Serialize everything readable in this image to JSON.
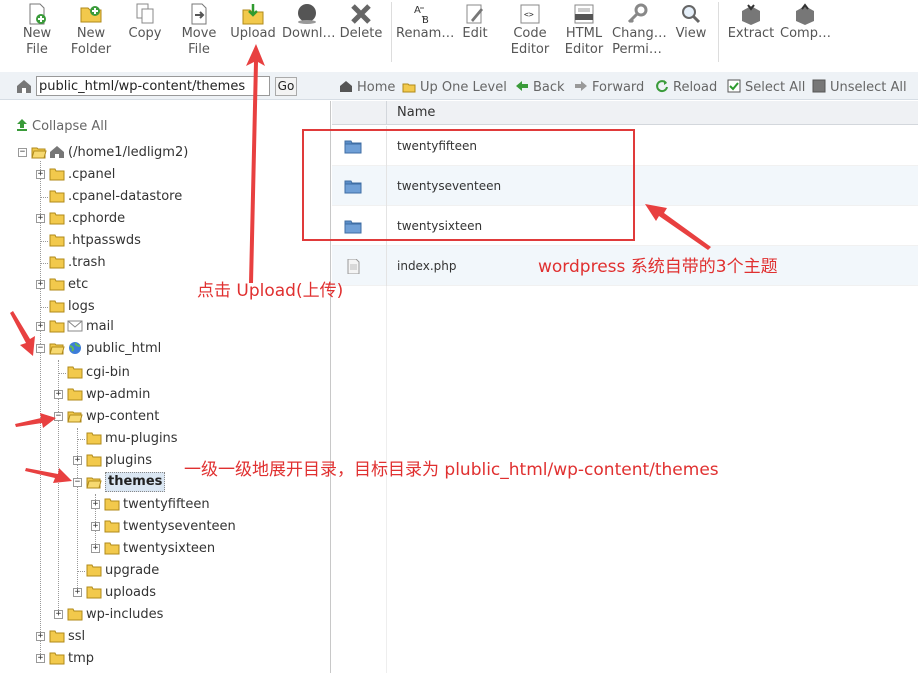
{
  "toolbar": {
    "buttons": [
      {
        "label": "New\nFile",
        "icon": "new-file-icon"
      },
      {
        "label": "New\nFolder",
        "icon": "new-folder-icon"
      },
      {
        "label": "Copy",
        "icon": "copy-icon"
      },
      {
        "label": "Move\nFile",
        "icon": "move-file-icon"
      },
      {
        "label": "Upload",
        "icon": "upload-icon"
      },
      {
        "label": "Downl…",
        "icon": "download-icon"
      },
      {
        "label": "Delete",
        "icon": "delete-icon"
      },
      {
        "label": "Renam…",
        "icon": "rename-icon"
      },
      {
        "label": "Edit",
        "icon": "edit-icon"
      },
      {
        "label": "Code\nEditor",
        "icon": "code-editor-icon"
      },
      {
        "label": "HTML\nEditor",
        "icon": "html-editor-icon"
      },
      {
        "label": "Chang…\nPermi…",
        "icon": "permissions-icon"
      },
      {
        "label": "View",
        "icon": "view-icon"
      },
      {
        "label": "Extract",
        "icon": "extract-icon"
      },
      {
        "label": "Comp…",
        "icon": "compress-icon"
      }
    ]
  },
  "pathbar": {
    "path": "public_html/wp-content/themes",
    "go_label": "Go"
  },
  "navbar": {
    "home": "Home",
    "up": "Up One Level",
    "back": "Back",
    "forward": "Forward",
    "reload": "Reload",
    "select_all": "Select All",
    "unselect_all": "Unselect All"
  },
  "tree": {
    "collapse_all": "Collapse All",
    "root": "(/home1/ledligm2)",
    "nodes": [
      {
        "label": ".cpanel",
        "expander": "+"
      },
      {
        "label": ".cpanel-datastore",
        "expander": ""
      },
      {
        "label": ".cphorde",
        "expander": "+"
      },
      {
        "label": ".htpasswds",
        "expander": ""
      },
      {
        "label": ".trash",
        "expander": ""
      },
      {
        "label": "etc",
        "expander": "+"
      },
      {
        "label": "logs",
        "expander": ""
      },
      {
        "label": "mail",
        "expander": "+"
      },
      {
        "label": "public_html",
        "expander": "−"
      },
      {
        "label": "cgi-bin",
        "expander": ""
      },
      {
        "label": "wp-admin",
        "expander": "+"
      },
      {
        "label": "wp-content",
        "expander": "−"
      },
      {
        "label": "mu-plugins",
        "expander": ""
      },
      {
        "label": "plugins",
        "expander": "+"
      },
      {
        "label": "themes",
        "expander": "−"
      },
      {
        "label": "twentyfifteen",
        "expander": "+"
      },
      {
        "label": "twentyseventeen",
        "expander": "+"
      },
      {
        "label": "twentysixteen",
        "expander": "+"
      },
      {
        "label": "upgrade",
        "expander": ""
      },
      {
        "label": "uploads",
        "expander": "+"
      },
      {
        "label": "wp-includes",
        "expander": "+"
      },
      {
        "label": "ssl",
        "expander": "+"
      },
      {
        "label": "tmp",
        "expander": "+"
      }
    ]
  },
  "filelist": {
    "column_name": "Name",
    "rows": [
      {
        "name": "twentyfifteen",
        "type": "folder"
      },
      {
        "name": "twentyseventeen",
        "type": "folder"
      },
      {
        "name": "twentysixteen",
        "type": "folder"
      },
      {
        "name": "index.php",
        "type": "file"
      }
    ]
  },
  "annotations": {
    "upload_note": "点击 Upload(上传)",
    "themes_note": "wordpress 系统自带的3个主题",
    "tree_note": "一级一级地展开目录，目标目录为 plublic_html/wp-content/themes"
  },
  "colors": {
    "annotation": "#e03030",
    "folder": "#f2c94c",
    "selected_bg": "#dbe7f3"
  }
}
